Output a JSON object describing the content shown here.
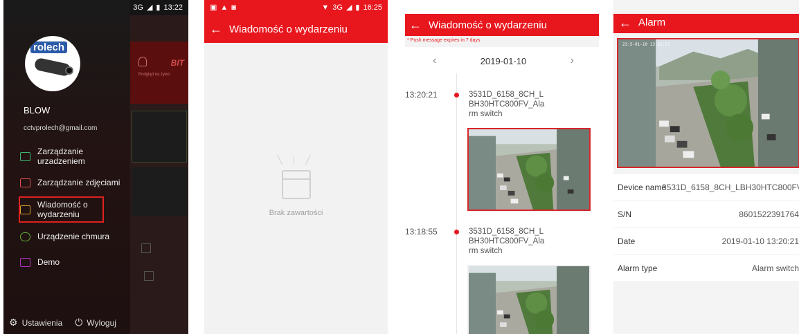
{
  "screen1": {
    "status": {
      "time": "13:22",
      "network": "3G"
    },
    "background": {
      "brand": "BIT",
      "tab_label": "Podgląd na żywo"
    },
    "user": {
      "name": "BLOW",
      "email": "cctvprolech@gmail.com",
      "avatar_logo": "rolech"
    },
    "menu": [
      {
        "label": "Zarządzanie urzadzeniem",
        "icon": "camera-icon",
        "color": "#3cb371"
      },
      {
        "label": "Zarządzanie zdjęciami",
        "icon": "image-icon",
        "color": "#e05050"
      },
      {
        "label": "Wiadomość o wydarzeniu",
        "icon": "message-icon",
        "color": "#e0a030",
        "highlighted": true
      },
      {
        "label": "Urządzenie chmura",
        "icon": "cloud-icon",
        "color": "#60b030"
      },
      {
        "label": "Demo",
        "icon": "demo-icon",
        "color": "#b030c0"
      }
    ],
    "footer": {
      "settings_label": "Ustawienia",
      "logout_label": "Wyloguj"
    }
  },
  "screen2": {
    "status": {
      "time": "16:25",
      "network": "3G"
    },
    "title": "Wiadomość o wydarzeniu",
    "empty_text": "Brak zawartości"
  },
  "screen3": {
    "title": "Wiadomość o wydarzeniu",
    "notice": "* Push message expires in 7 days",
    "date": "2019-01-10",
    "events": [
      {
        "time": "13:20:21",
        "name": "3531D_6158_8CH_LBH30HTC800FV_Alarm switch"
      },
      {
        "time": "13:18:55",
        "name": "3531D_6158_8CH_LBH30HTC800FV_Alarm switch"
      }
    ]
  },
  "screen4": {
    "title": "Alarm",
    "photo_timestamp": "23:5-01-10 13:21:27",
    "details": [
      {
        "label": "Device name",
        "value": "3531D_6158_8CH_LBH30HTC800FV"
      },
      {
        "label": "S/N",
        "value": "8601522391764"
      },
      {
        "label": "Date",
        "value": "2019-01-10 13:20:21"
      },
      {
        "label": "Alarm type",
        "value": "Alarm switch"
      }
    ]
  },
  "colors": {
    "accent_red": "#e8161d",
    "drawer_bg": "#1a1a1a"
  }
}
